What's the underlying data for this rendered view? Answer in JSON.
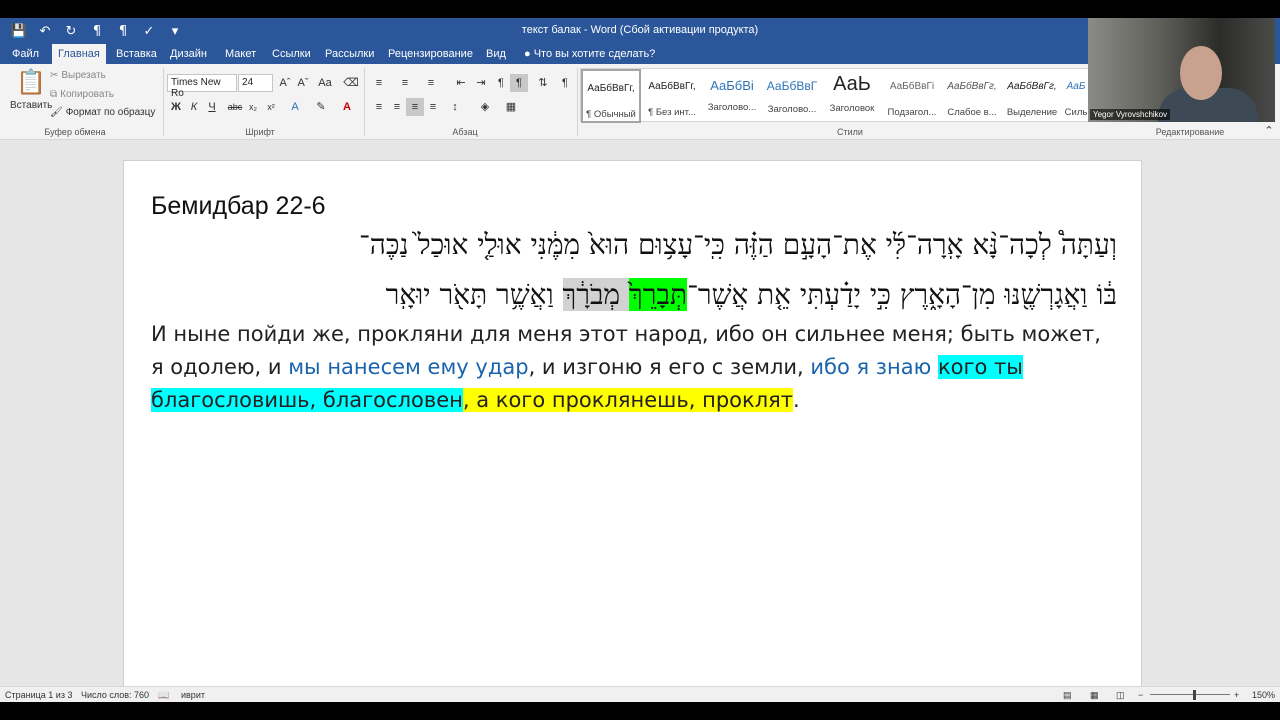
{
  "window": {
    "title": "текст балак - Word (Сбой активации продукта)"
  },
  "qat": [
    "save-icon",
    "undo-icon",
    "redo-icon",
    "rtl-icon",
    "ltr-icon",
    "spellcheck-icon"
  ],
  "tabs": [
    "Файл",
    "Главная",
    "Вставка",
    "Дизайн",
    "Макет",
    "Ссылки",
    "Рассылки",
    "Рецензирование",
    "Вид"
  ],
  "tell_me": "Что вы хотите сделать?",
  "clipboard": {
    "paste": "Вставить",
    "cut": "Вырезать",
    "copy": "Копировать",
    "format_painter": "Формат по образцу",
    "group": "Буфер обмена"
  },
  "font": {
    "name": "Times New Ro",
    "size": "24",
    "group": "Шрифт",
    "bold": "Ж",
    "italic": "К",
    "underline": "Ч"
  },
  "paragraph": {
    "group": "Абзац"
  },
  "styles": {
    "group": "Стили",
    "items": [
      {
        "preview": "АаБбВвГг,",
        "name": "¶ Обычный"
      },
      {
        "preview": "АаБбВвГг,",
        "name": "¶ Без инт..."
      },
      {
        "preview": "АаБбВі",
        "name": "Заголово..."
      },
      {
        "preview": "АаБбВвГ",
        "name": "Заголово..."
      },
      {
        "preview": "АаЬ",
        "name": "Заголовок"
      },
      {
        "preview": "АаБбВвГі",
        "name": "Подзагол..."
      },
      {
        "preview": "АаБбВвГг,",
        "name": "Слабое в..."
      },
      {
        "preview": "АаБбВвГг,",
        "name": "Выделение"
      },
      {
        "preview": "АаБ",
        "name": "Силь"
      }
    ]
  },
  "editing": {
    "group": "Редактирование"
  },
  "video": {
    "name": "Yegor Vyrovshchikov"
  },
  "document": {
    "heading": "Бемидбар 22-6",
    "hebrew_line1": "וְעַתָּה֩ לְכָה־נָּ֨א אָֽרָה־לִּ֜י אֶת־הָעָ֣ם הַזֶּ֗ה כִּֽי־עָצ֥וּם הוּא֙ מִמֶּ֔נִּי אוּלַ֤י אוּכַל֙ נַכֶּה־",
    "hebrew_line2_a": "בּ֔וֹ וַאֲגָרְשֶׁ֖נּוּ מִן־הָאָ֑רֶץ כִּ֣י יָדַ֗עְתִּי אֵ֤ת אֲשֶׁר־",
    "hebrew_line2_green": "תְּבָרֵךְ֙",
    "hebrew_line2_b": " מְבֹרָ֔ךְ",
    "hebrew_line2_c": " וַאֲשֶׁ֥ר תָּאֹ֖ר יוּאָֽר",
    "ru_part1": "И ныне пойди же, прокляни для меня этот народ, ибо он сильнее меня; быть может, я одолею, и ",
    "ru_blue1": "мы нанесем ему удар",
    "ru_part2": ", и изгоню я его с земли, ",
    "ru_blue2": "ибо я знаю ",
    "ru_cyan": "кого ты благословишь, благословен",
    "ru_yellow": ", а кого проклянешь, проклят",
    "ru_end": "."
  },
  "status": {
    "page": "Страница 1 из 3",
    "words": "Число слов: 760",
    "lang": "иврит",
    "zoom": "150%"
  }
}
